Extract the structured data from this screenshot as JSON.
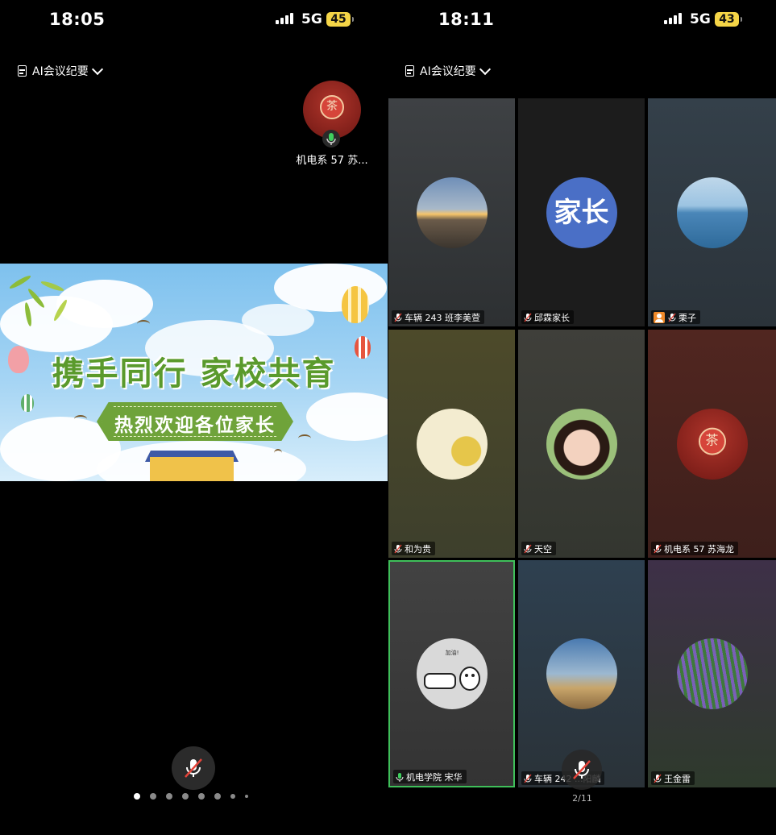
{
  "left": {
    "status": {
      "time": "18:05",
      "network": "5G",
      "battery": "45"
    },
    "ai_summary_label": "AI会议纪要",
    "active_speaker": {
      "name": "机电系 57 苏...",
      "avatar_text": "茶"
    },
    "banner": {
      "title": "携手同行  家校共育",
      "subtitle": "热烈欢迎各位家长"
    },
    "page_dots": {
      "count": 8,
      "active": 0
    }
  },
  "right": {
    "status": {
      "time": "18:11",
      "network": "5G",
      "battery": "43"
    },
    "ai_summary_label": "AI会议纪要",
    "participants": [
      {
        "name": "车辆 243 班李美萱",
        "avatar": "photo-sunset-girl",
        "mic": "muted",
        "bg": "#3a3d40"
      },
      {
        "name": "邱霖家长",
        "avatar_text": "家长",
        "mic": "muted",
        "bg": "#1c1c1c"
      },
      {
        "name": "栗子",
        "avatar": "photo-sea-girl",
        "mic": "muted",
        "host": true,
        "bg": "#2f3a44"
      },
      {
        "name": "和为贵",
        "avatar": "photo-calligraphy",
        "mic": "muted",
        "bg": "#4a4a2a"
      },
      {
        "name": "天空",
        "avatar": "photo-smiling-woman",
        "mic": "muted",
        "bg": "#3a3a36"
      },
      {
        "name": "机电系 57 苏海龙",
        "avatar": "photo-red-emblem",
        "avatar_text": "茶",
        "mic": "muted",
        "bg": "#4a2420"
      },
      {
        "name": "机电学院 宋华",
        "avatar": "photo-cartoon-fist",
        "mic": "active",
        "active": true,
        "bg": "#3c3c3c"
      },
      {
        "name": "车辆 242 ...阳麟",
        "avatar": "photo-statue",
        "mic": "muted",
        "bg": "#2e3b46"
      },
      {
        "name": "王金雷",
        "avatar": "photo-lavender",
        "mic": "muted",
        "bg": "#3a2e46"
      }
    ],
    "page_indicator": "2/11"
  },
  "colors": {
    "active_speaker_border": "#3fbf5a",
    "battery": "#f5d547",
    "host_badge": "#f08a2a",
    "banner_title": "#5a9a2c"
  }
}
